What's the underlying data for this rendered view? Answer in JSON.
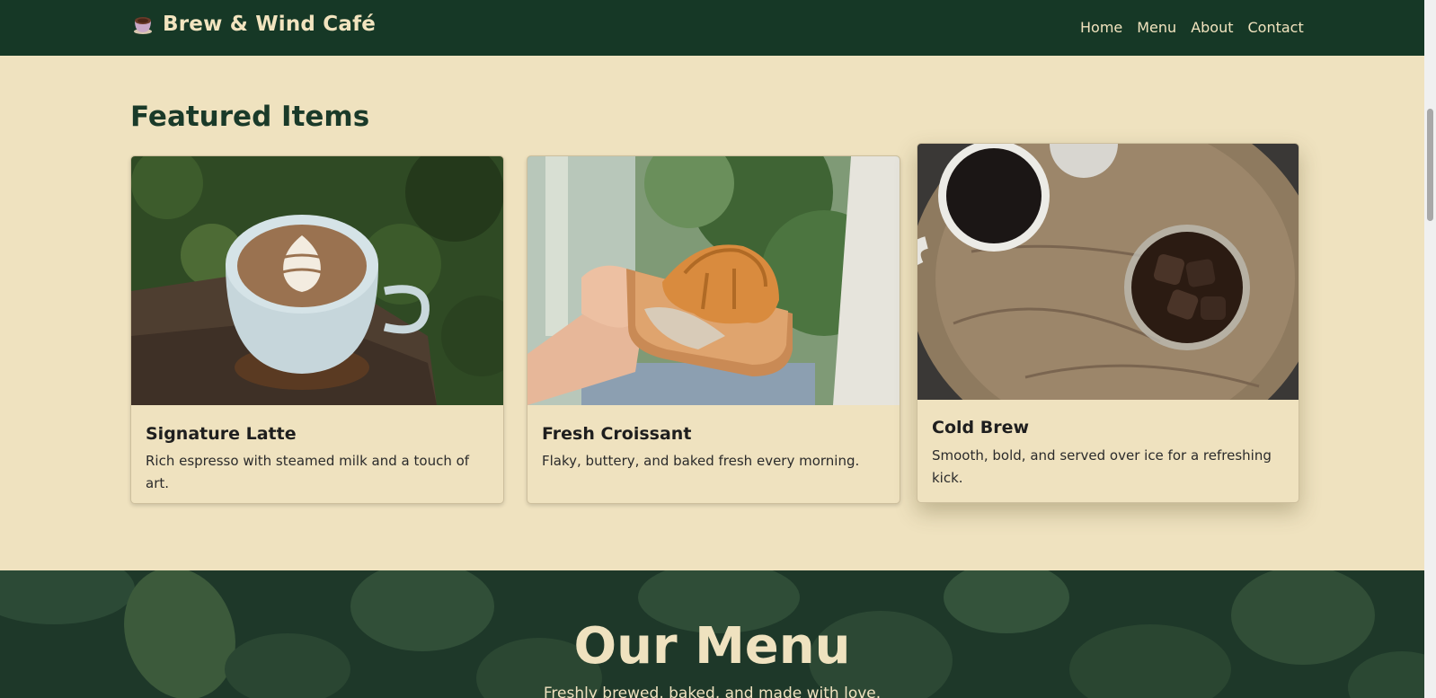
{
  "brand": {
    "name": "Brew & Wind Café",
    "icon": "coffee-cup-icon"
  },
  "nav": {
    "items": [
      "Home",
      "Menu",
      "About",
      "Contact"
    ]
  },
  "featured": {
    "heading": "Featured Items",
    "cards": [
      {
        "title": "Signature Latte",
        "description": "Rich espresso with steamed milk and a touch of art.",
        "image": "latte-art-photo"
      },
      {
        "title": "Fresh Croissant",
        "description": "Flaky, buttery, and baked fresh every morning.",
        "image": "croissant-on-tray-photo"
      },
      {
        "title": "Cold Brew",
        "description": "Smooth, bold, and served over ice for a refreshing kick.",
        "image": "coffee-cups-on-wood-photo"
      }
    ]
  },
  "menu_section": {
    "title": "Our Menu",
    "subtitle": "Freshly brewed, baked, and made with love."
  },
  "colors": {
    "nav_bg": "#163826",
    "page_bg": "#efe2bf",
    "accent_text": "#f2e4bf",
    "heading": "#1a3a29"
  }
}
